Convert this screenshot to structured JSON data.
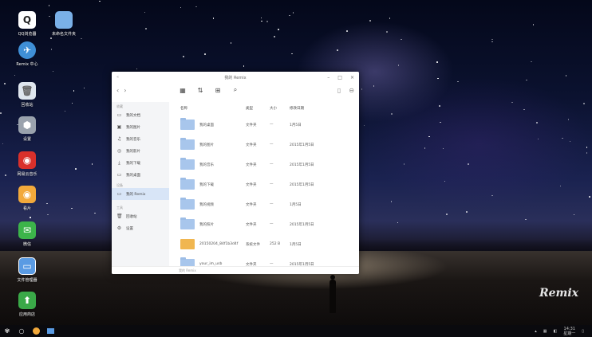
{
  "window": {
    "title": "我的 Remix",
    "controls": [
      "–",
      "□",
      "×"
    ]
  },
  "toolbar": {
    "back": "‹",
    "forward": "›",
    "view_icon": "grid-view-icon",
    "sort_icon": "sort-icon",
    "newfolder_icon": "new-folder-icon",
    "search_icon": "search-icon",
    "trash_icon": "trash-icon",
    "more_icon": "more-icon"
  },
  "sidebar": {
    "group1": "收藏",
    "items": [
      {
        "label": "我的文档",
        "icon": "▭"
      },
      {
        "label": "我的图片",
        "icon": "▣"
      },
      {
        "label": "我的音乐",
        "icon": "♫"
      },
      {
        "label": "我的影片",
        "icon": "◎"
      },
      {
        "label": "我的下载",
        "icon": "⤓"
      },
      {
        "label": "我的桌面",
        "icon": "▭"
      }
    ],
    "group2": "设备",
    "device": {
      "label": "我的 Remix",
      "icon": "▭"
    },
    "group3": "工具",
    "tools": [
      {
        "label": "回收站",
        "icon": "🗑"
      },
      {
        "label": "设置",
        "icon": "⚙"
      }
    ]
  },
  "table": {
    "headers": {
      "name": "名称",
      "type": "类型",
      "size": "大小",
      "date": "修改日期"
    },
    "rows": [
      {
        "name": "我的桌面",
        "type": "文件夹",
        "size": "—",
        "date": "1月5日",
        "kind": "folder"
      },
      {
        "name": "我的图片",
        "type": "文件夹",
        "size": "—",
        "date": "2015年1月5日",
        "kind": "folder"
      },
      {
        "name": "我的音乐",
        "type": "文件夹",
        "size": "—",
        "date": "2015年1月5日",
        "kind": "folder"
      },
      {
        "name": "我的下载",
        "type": "文件夹",
        "size": "—",
        "date": "2015年1月5日",
        "kind": "folder"
      },
      {
        "name": "我的视频",
        "type": "文件夹",
        "size": "—",
        "date": "1月5日",
        "kind": "folder"
      },
      {
        "name": "我的照片",
        "type": "文件夹",
        "size": "—",
        "date": "2015年1月5日",
        "kind": "folder"
      },
      {
        "name": "20150204_84f1b3d4f",
        "type": "系统文件",
        "size": "252 B",
        "date": "1月5日",
        "kind": "file"
      },
      {
        "name": "your_im_usb",
        "type": "文件夹",
        "size": "—",
        "date": "2015年1月5日",
        "kind": "folder"
      }
    ]
  },
  "statusbar": {
    "text": "我的 Remix"
  },
  "desktop": {
    "icons": [
      {
        "label": "QQ浏览器",
        "color": "#ffffff",
        "glyph": "Q"
      },
      {
        "label": "未命名文件夹",
        "color": "#7ab0e8",
        "glyph": ""
      },
      {
        "label": "Remix 中心",
        "color": "#3f8fd6",
        "glyph": "✈"
      },
      {
        "label": "回收站",
        "color": "#dfe6ee",
        "glyph": "🗑"
      },
      {
        "label": "设置",
        "color": "#9aa2ad",
        "glyph": "⬢"
      },
      {
        "label": "网易云音乐",
        "color": "#d9302b",
        "glyph": "◉"
      },
      {
        "label": "看片",
        "color": "#f2a93b",
        "glyph": "◉"
      },
      {
        "label": "微信",
        "color": "#3cb44a",
        "glyph": "✉"
      },
      {
        "label": "文件管理器",
        "color": "#5a9be3",
        "glyph": "▭"
      },
      {
        "label": "应用商店",
        "color": "#3aa948",
        "glyph": "⬆"
      }
    ],
    "logo": "Remix"
  },
  "taskbar": {
    "start_icon": "remix-start-icon",
    "time": "14:31",
    "date": "星期一"
  }
}
